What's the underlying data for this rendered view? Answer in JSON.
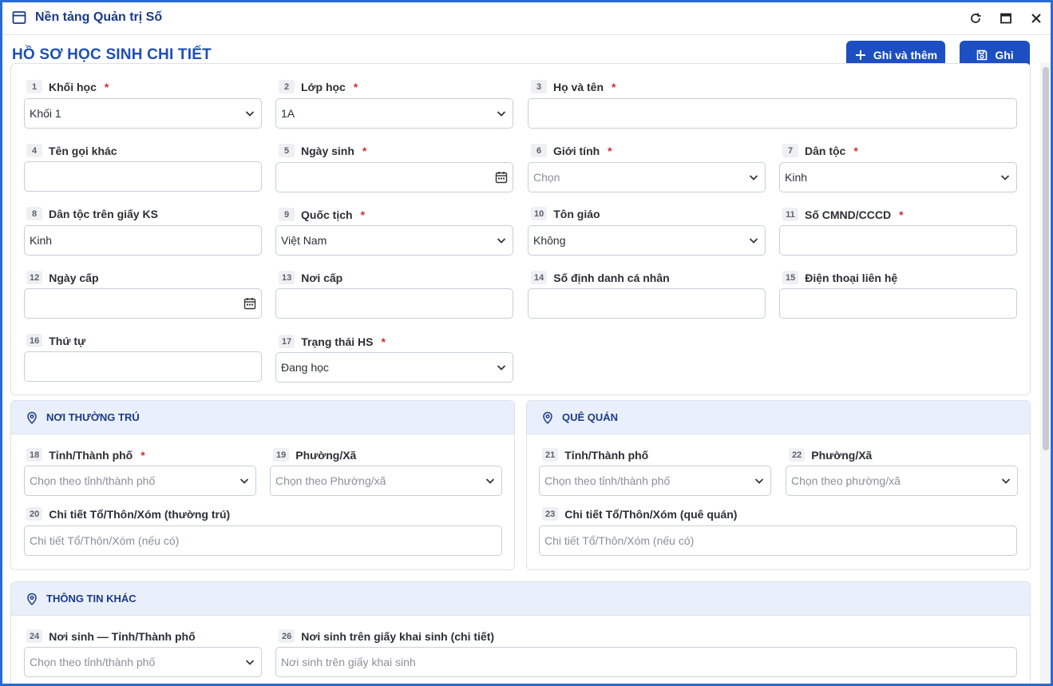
{
  "window": {
    "title": "Nền tảng Quản trị Số",
    "icon": "window-icon",
    "controls": [
      "refresh-icon",
      "maximize-icon",
      "close-icon"
    ]
  },
  "header": {
    "title": "HỒ SƠ HỌC SINH CHI TIẾT",
    "save_add_label": "Ghi và thêm",
    "save_label": "Ghi"
  },
  "colors": {
    "accent": "#1c4fc1",
    "required": "#d92b2b",
    "section_bg": "#eaf0fb",
    "frame": "#2a6bd1"
  },
  "fields": [
    {
      "num": "1",
      "label": "Khối học",
      "required": true,
      "type": "select",
      "value": "Khối 1",
      "placeholder": ""
    },
    {
      "num": "2",
      "label": "Lớp học",
      "required": true,
      "type": "select",
      "value": "1A",
      "placeholder": ""
    },
    {
      "num": "3",
      "label": "Họ và tên",
      "required": true,
      "type": "text",
      "value": "",
      "placeholder": ""
    },
    {
      "num": "4",
      "label": "Tên gọi khác",
      "required": false,
      "type": "text",
      "value": "",
      "placeholder": ""
    },
    {
      "num": "5",
      "label": "Ngày sinh",
      "required": true,
      "type": "date",
      "value": "",
      "placeholder": ""
    },
    {
      "num": "6",
      "label": "Giới tính",
      "required": true,
      "type": "select",
      "value": "",
      "placeholder": "Chọn"
    },
    {
      "num": "7",
      "label": "Dân tộc",
      "required": true,
      "type": "select",
      "value": "Kinh",
      "placeholder": ""
    },
    {
      "num": "8",
      "label": "Dân tộc trên giấy KS",
      "required": false,
      "type": "text",
      "value": "Kinh",
      "placeholder": ""
    },
    {
      "num": "9",
      "label": "Quốc tịch",
      "required": true,
      "type": "select",
      "value": "Việt Nam",
      "placeholder": ""
    },
    {
      "num": "10",
      "label": "Tôn giáo",
      "required": false,
      "type": "select",
      "value": "Không",
      "placeholder": ""
    },
    {
      "num": "11",
      "label": "Số CMND/CCCD",
      "required": true,
      "type": "text",
      "value": "",
      "placeholder": ""
    },
    {
      "num": "12",
      "label": "Ngày cấp",
      "required": false,
      "type": "date",
      "value": "",
      "placeholder": ""
    },
    {
      "num": "13",
      "label": "Nơi cấp",
      "required": false,
      "type": "text",
      "value": "",
      "placeholder": ""
    },
    {
      "num": "14",
      "label": "Số định danh cá nhân",
      "required": false,
      "type": "text",
      "value": "",
      "placeholder": ""
    },
    {
      "num": "15",
      "label": "Điện thoại liên hệ",
      "required": false,
      "type": "text",
      "value": "",
      "placeholder": ""
    },
    {
      "num": "16",
      "label": "Thứ tự",
      "required": false,
      "type": "text",
      "value": "",
      "placeholder": ""
    },
    {
      "num": "17",
      "label": "Trạng thái HS",
      "required": true,
      "type": "select",
      "value": "Đang học",
      "placeholder": ""
    }
  ],
  "permanent_address": {
    "title": "NƠI THƯỜNG TRÚ",
    "fields": [
      {
        "num": "18",
        "label": "Tỉnh/Thành phố",
        "required": true,
        "type": "select",
        "value": "",
        "placeholder": "Chọn theo tỉnh/thành phố"
      },
      {
        "num": "19",
        "label": "Phường/Xã",
        "required": false,
        "type": "select",
        "value": "",
        "placeholder": "Chọn theo Phường/xã"
      },
      {
        "num": "20",
        "label": "Chi tiết Tổ/Thôn/Xóm (thường trú)",
        "required": false,
        "type": "text",
        "value": "",
        "placeholder": "Chi tiết Tổ/Thôn/Xóm (nếu có)"
      }
    ]
  },
  "hometown": {
    "title": "QUÊ QUÁN",
    "fields": [
      {
        "num": "21",
        "label": "Tỉnh/Thành phố",
        "required": false,
        "type": "select",
        "value": "",
        "placeholder": "Chọn theo tỉnh/thành phố"
      },
      {
        "num": "22",
        "label": "Phường/Xã",
        "required": false,
        "type": "select",
        "value": "",
        "placeholder": "Chọn theo phường/xã"
      },
      {
        "num": "23",
        "label": "Chi tiết Tổ/Thôn/Xóm (quê quán)",
        "required": false,
        "type": "text",
        "value": "",
        "placeholder": "Chi tiết Tổ/Thôn/Xóm (nếu có)"
      }
    ]
  },
  "other_info": {
    "title": "THÔNG TIN KHÁC",
    "fields": [
      {
        "num": "24",
        "label": "Nơi sinh — Tỉnh/Thành phố",
        "required": false,
        "type": "select",
        "value": "",
        "placeholder": "Chọn theo tỉnh/thành phố"
      },
      {
        "num": "26",
        "label": "Nơi sinh trên giấy khai sinh (chi tiết)",
        "required": false,
        "type": "text",
        "value": "",
        "placeholder": "Nơi sinh trên giấy khai sinh"
      }
    ]
  }
}
